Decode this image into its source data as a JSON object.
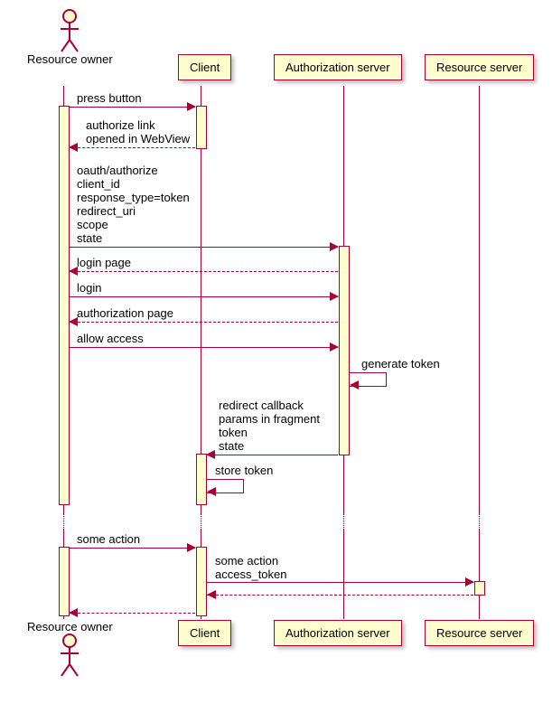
{
  "chart_data": {
    "type": "sequence-diagram",
    "participants": [
      {
        "id": "owner",
        "name": "Resource owner",
        "kind": "actor"
      },
      {
        "id": "client",
        "name": "Client",
        "kind": "box"
      },
      {
        "id": "auth",
        "name": "Authorization server",
        "kind": "box"
      },
      {
        "id": "res",
        "name": "Resource server",
        "kind": "box"
      }
    ],
    "messages": [
      {
        "from": "owner",
        "to": "client",
        "label": "press button",
        "style": "solid"
      },
      {
        "from": "client",
        "to": "owner",
        "label": "authorize link\nopened in WebView",
        "style": "dashed"
      },
      {
        "from": "owner",
        "to": "auth",
        "label": "oauth/authorize\nclient_id\nresponse_type=token\nredirect_uri\nscope\nstate",
        "style": "solid"
      },
      {
        "from": "auth",
        "to": "owner",
        "label": "login page",
        "style": "dashed"
      },
      {
        "from": "owner",
        "to": "auth",
        "label": "login",
        "style": "solid"
      },
      {
        "from": "auth",
        "to": "owner",
        "label": "authorization page",
        "style": "dashed"
      },
      {
        "from": "owner",
        "to": "auth",
        "label": "allow access",
        "style": "solid"
      },
      {
        "from": "auth",
        "to": "auth",
        "label": "generate token",
        "style": "solid",
        "self": true
      },
      {
        "from": "auth",
        "to": "client",
        "label": "redirect callback\nparams in fragment\ntoken\nstate",
        "style": "solid"
      },
      {
        "from": "client",
        "to": "client",
        "label": "store token",
        "style": "solid",
        "self": true
      },
      {
        "divider": true
      },
      {
        "from": "owner",
        "to": "client",
        "label": "some action",
        "style": "solid"
      },
      {
        "from": "client",
        "to": "res",
        "label": "some action\naccess_token",
        "style": "solid"
      },
      {
        "from": "res",
        "to": "client",
        "label": "",
        "style": "dashed"
      },
      {
        "from": "client",
        "to": "owner",
        "label": "",
        "style": "dashed"
      }
    ]
  },
  "participants": {
    "owner": "Resource owner",
    "client": "Client",
    "auth": "Authorization server",
    "res": "Resource server"
  },
  "msg": {
    "m1": "press button",
    "m2": "authorize link\nopened in WebView",
    "m3": "oauth/authorize\nclient_id\nresponse_type=token\nredirect_uri\nscope\nstate",
    "m4": "login page",
    "m5": "login",
    "m6": "authorization page",
    "m7": "allow access",
    "m8": "generate token",
    "m9": "redirect callback\nparams in fragment\ntoken\nstate",
    "m10": "store token",
    "m11": "some action",
    "m12": "some action\naccess_token"
  }
}
